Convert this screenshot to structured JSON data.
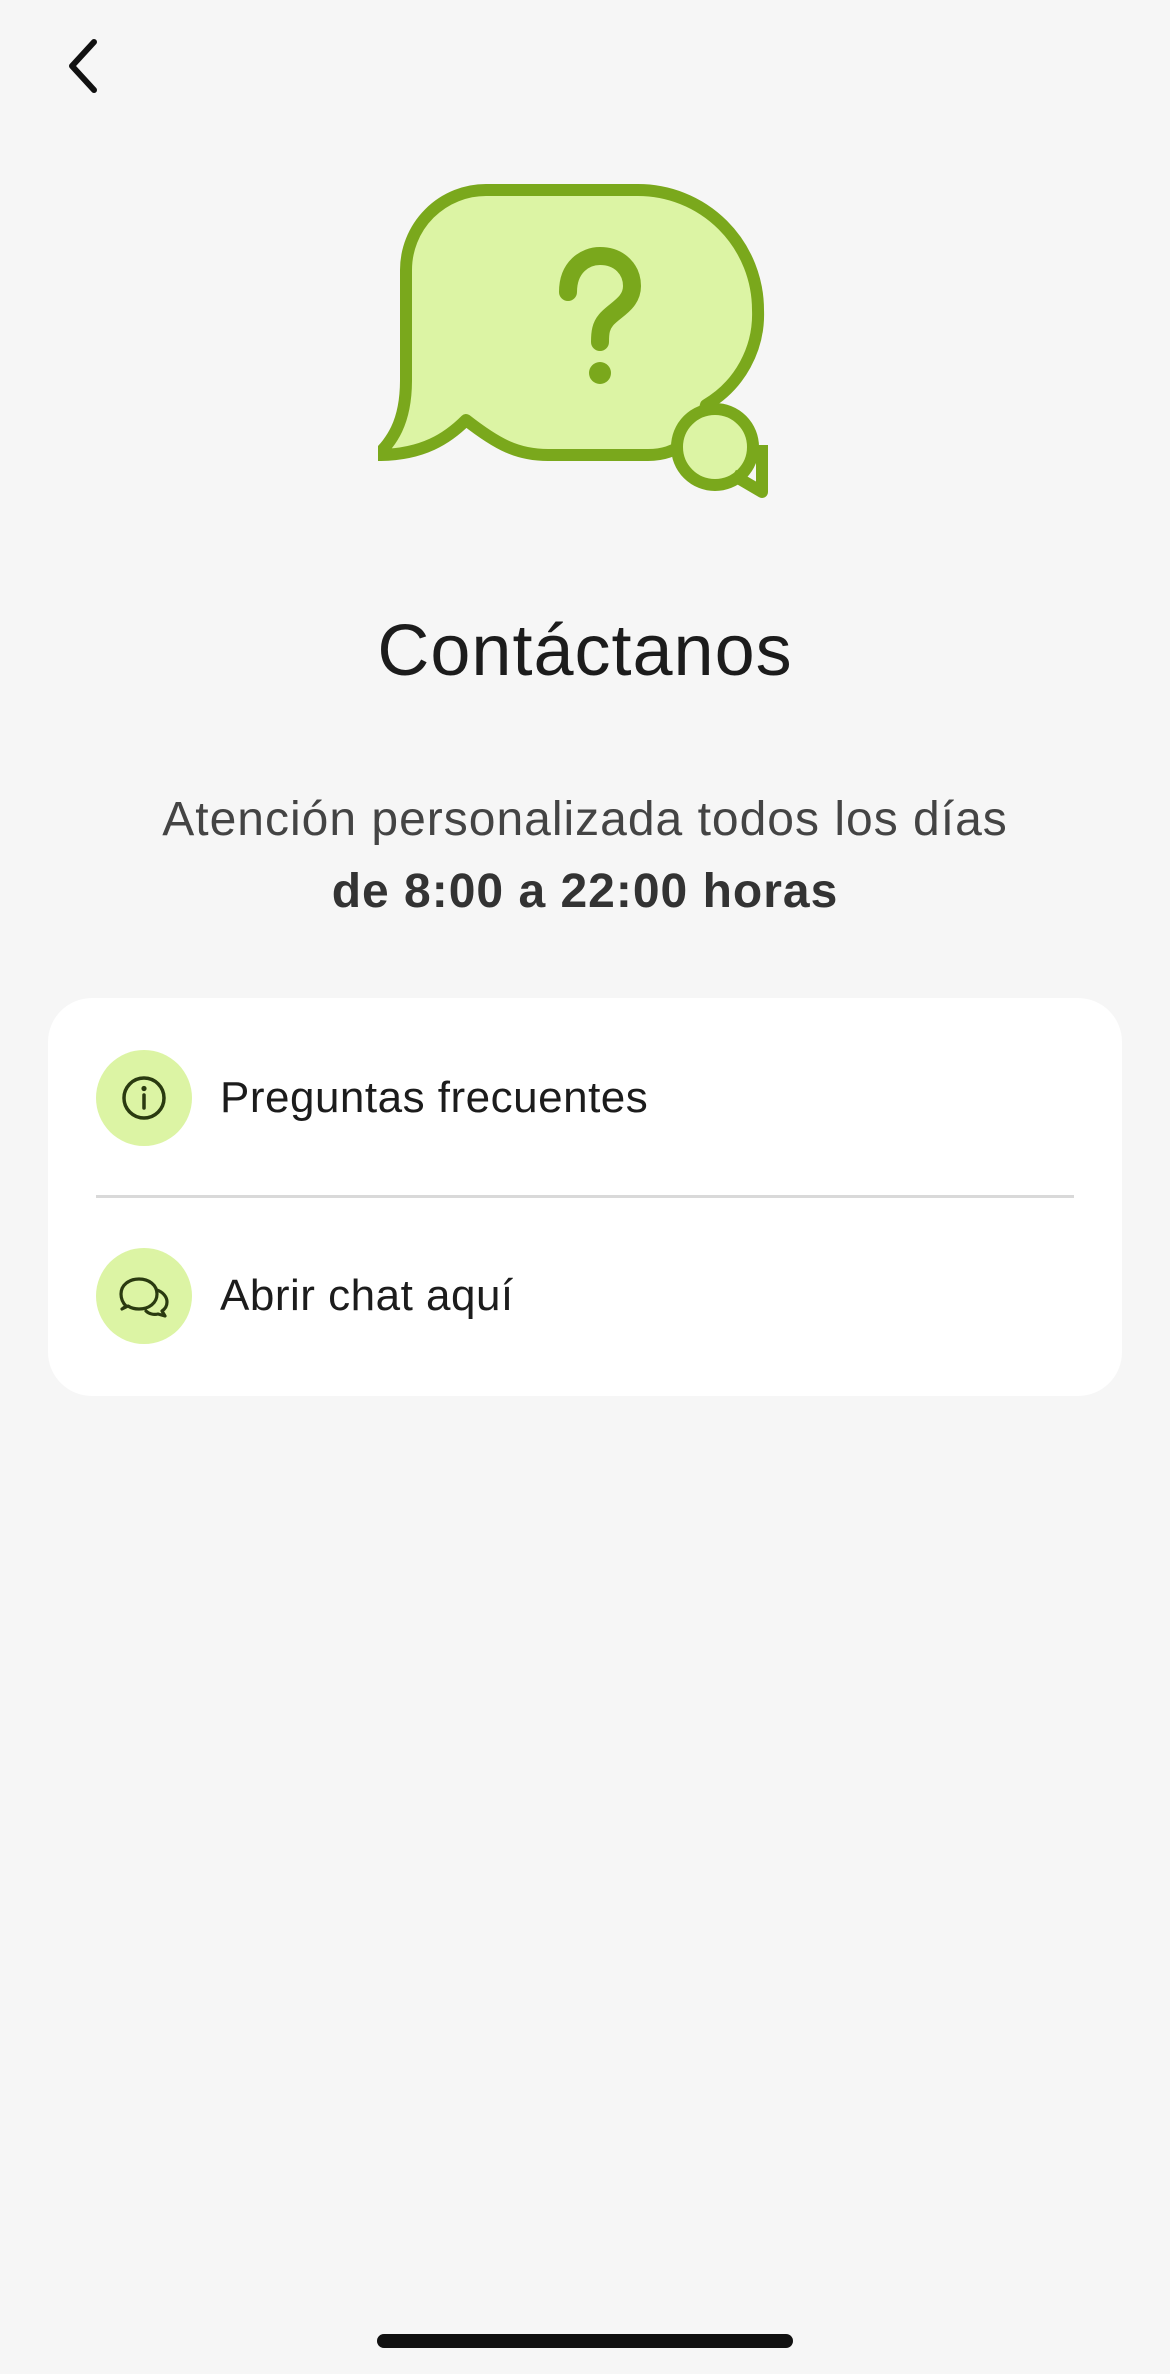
{
  "header": {
    "back_icon": "chevron-left-icon"
  },
  "hero": {
    "icon": "speech-bubble-question-icon",
    "colors": {
      "fill": "#dcf4a4",
      "stroke": "#7aa81c"
    }
  },
  "main": {
    "title": "Contáctanos",
    "subtitle_line1": "Atención personalizada todos los días",
    "subtitle_line2": "de 8:00 a 22:00 horas"
  },
  "options": [
    {
      "label": "Preguntas frecuentes",
      "icon": "info-circle-icon"
    },
    {
      "label": "Abrir chat aquí",
      "icon": "chat-bubbles-icon"
    }
  ],
  "colors": {
    "background": "#f6f6f6",
    "card": "#ffffff",
    "accent_light": "#dcf4a4",
    "accent_dark": "#7aa81c",
    "text": "#1c1c1c"
  }
}
